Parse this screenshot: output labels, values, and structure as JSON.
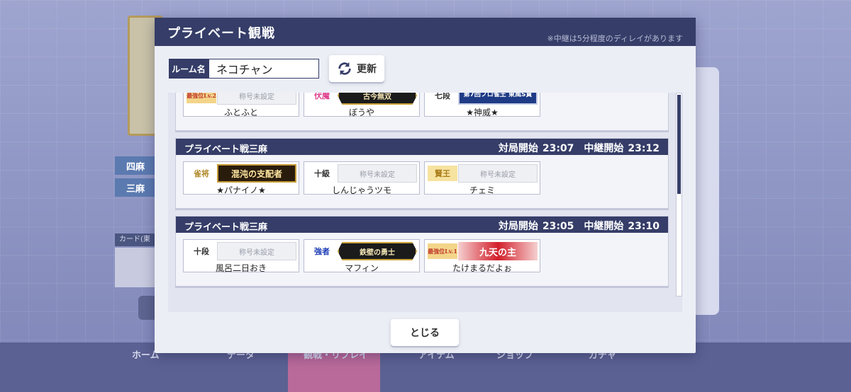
{
  "dialog": {
    "title": "プライベート観戦",
    "note": "※中継は5分程度のディレイがあります",
    "room_label": "ルーム名",
    "room_value": "ネコチャン",
    "refresh_label": "更新",
    "close_label": "とじる"
  },
  "rooms": [
    {
      "name": "",
      "start_label": "",
      "start_time": "",
      "relay_label": "",
      "relay_time": "",
      "players": [
        {
          "rank": "最強位Lv.2",
          "title": "称号未設定",
          "title_style": "plain",
          "name": "ふとふと"
        },
        {
          "rank": "伏魔",
          "title": "古今無双",
          "title_style": "gold",
          "name": "ぼうや"
        },
        {
          "rank": "七段",
          "title": "第7回プロ雀王 東風S賞",
          "title_style": "blue",
          "name": "★神威★"
        }
      ]
    },
    {
      "name": "プライベート戦三麻",
      "start_label": "対局開始",
      "start_time": "23:07",
      "relay_label": "中継開始",
      "relay_time": "23:12",
      "players": [
        {
          "rank": "雀将",
          "title": "混沌の支配者",
          "title_style": "brush",
          "name": "★パナイノ★"
        },
        {
          "rank": "十級",
          "title": "称号未設定",
          "title_style": "plain",
          "name": "しんじゃうツモ"
        },
        {
          "rank": "賢王",
          "title": "称号未設定",
          "title_style": "plain",
          "name": "チェミ"
        }
      ]
    },
    {
      "name": "プライベート戦三麻",
      "start_label": "対局開始",
      "start_time": "23:05",
      "relay_label": "中継開始",
      "relay_time": "23:10",
      "players": [
        {
          "rank": "十段",
          "title": "称号未設定",
          "title_style": "plain",
          "name": "風呂二日おき"
        },
        {
          "rank": "強者",
          "title": "鉄壁の勇士",
          "title_style": "gold",
          "name": "マフィン"
        },
        {
          "rank": "最強位Lv.1",
          "title": "九天の主",
          "title_style": "red",
          "name": "たけまるだよぉ"
        }
      ]
    }
  ],
  "background": {
    "tab_4ma": "四麻",
    "tab_3ma": "三麻",
    "card_label": "カード(東",
    "nav": [
      "ホーム",
      "データ",
      "観戦・リプレイ",
      "アイテム",
      "ショップ",
      "ガチャ"
    ]
  },
  "colors": {
    "header_navy": "#353d68",
    "dialog_bg": "#eceef6",
    "nav_active": "#b96a9b"
  }
}
